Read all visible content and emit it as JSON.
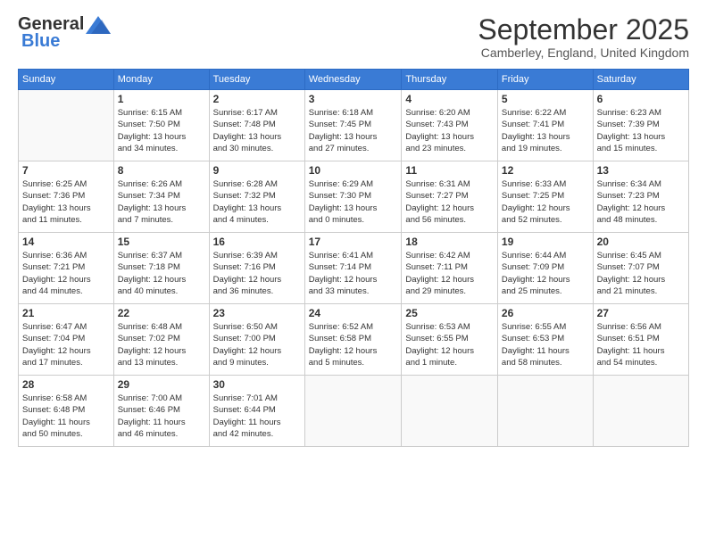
{
  "header": {
    "logo_general": "General",
    "logo_blue": "Blue",
    "month_title": "September 2025",
    "location": "Camberley, England, United Kingdom"
  },
  "days_of_week": [
    "Sunday",
    "Monday",
    "Tuesday",
    "Wednesday",
    "Thursday",
    "Friday",
    "Saturday"
  ],
  "weeks": [
    [
      {
        "day": "",
        "info": ""
      },
      {
        "day": "1",
        "info": "Sunrise: 6:15 AM\nSunset: 7:50 PM\nDaylight: 13 hours\nand 34 minutes."
      },
      {
        "day": "2",
        "info": "Sunrise: 6:17 AM\nSunset: 7:48 PM\nDaylight: 13 hours\nand 30 minutes."
      },
      {
        "day": "3",
        "info": "Sunrise: 6:18 AM\nSunset: 7:45 PM\nDaylight: 13 hours\nand 27 minutes."
      },
      {
        "day": "4",
        "info": "Sunrise: 6:20 AM\nSunset: 7:43 PM\nDaylight: 13 hours\nand 23 minutes."
      },
      {
        "day": "5",
        "info": "Sunrise: 6:22 AM\nSunset: 7:41 PM\nDaylight: 13 hours\nand 19 minutes."
      },
      {
        "day": "6",
        "info": "Sunrise: 6:23 AM\nSunset: 7:39 PM\nDaylight: 13 hours\nand 15 minutes."
      }
    ],
    [
      {
        "day": "7",
        "info": "Sunrise: 6:25 AM\nSunset: 7:36 PM\nDaylight: 13 hours\nand 11 minutes."
      },
      {
        "day": "8",
        "info": "Sunrise: 6:26 AM\nSunset: 7:34 PM\nDaylight: 13 hours\nand 7 minutes."
      },
      {
        "day": "9",
        "info": "Sunrise: 6:28 AM\nSunset: 7:32 PM\nDaylight: 13 hours\nand 4 minutes."
      },
      {
        "day": "10",
        "info": "Sunrise: 6:29 AM\nSunset: 7:30 PM\nDaylight: 13 hours\nand 0 minutes."
      },
      {
        "day": "11",
        "info": "Sunrise: 6:31 AM\nSunset: 7:27 PM\nDaylight: 12 hours\nand 56 minutes."
      },
      {
        "day": "12",
        "info": "Sunrise: 6:33 AM\nSunset: 7:25 PM\nDaylight: 12 hours\nand 52 minutes."
      },
      {
        "day": "13",
        "info": "Sunrise: 6:34 AM\nSunset: 7:23 PM\nDaylight: 12 hours\nand 48 minutes."
      }
    ],
    [
      {
        "day": "14",
        "info": "Sunrise: 6:36 AM\nSunset: 7:21 PM\nDaylight: 12 hours\nand 44 minutes."
      },
      {
        "day": "15",
        "info": "Sunrise: 6:37 AM\nSunset: 7:18 PM\nDaylight: 12 hours\nand 40 minutes."
      },
      {
        "day": "16",
        "info": "Sunrise: 6:39 AM\nSunset: 7:16 PM\nDaylight: 12 hours\nand 36 minutes."
      },
      {
        "day": "17",
        "info": "Sunrise: 6:41 AM\nSunset: 7:14 PM\nDaylight: 12 hours\nand 33 minutes."
      },
      {
        "day": "18",
        "info": "Sunrise: 6:42 AM\nSunset: 7:11 PM\nDaylight: 12 hours\nand 29 minutes."
      },
      {
        "day": "19",
        "info": "Sunrise: 6:44 AM\nSunset: 7:09 PM\nDaylight: 12 hours\nand 25 minutes."
      },
      {
        "day": "20",
        "info": "Sunrise: 6:45 AM\nSunset: 7:07 PM\nDaylight: 12 hours\nand 21 minutes."
      }
    ],
    [
      {
        "day": "21",
        "info": "Sunrise: 6:47 AM\nSunset: 7:04 PM\nDaylight: 12 hours\nand 17 minutes."
      },
      {
        "day": "22",
        "info": "Sunrise: 6:48 AM\nSunset: 7:02 PM\nDaylight: 12 hours\nand 13 minutes."
      },
      {
        "day": "23",
        "info": "Sunrise: 6:50 AM\nSunset: 7:00 PM\nDaylight: 12 hours\nand 9 minutes."
      },
      {
        "day": "24",
        "info": "Sunrise: 6:52 AM\nSunset: 6:58 PM\nDaylight: 12 hours\nand 5 minutes."
      },
      {
        "day": "25",
        "info": "Sunrise: 6:53 AM\nSunset: 6:55 PM\nDaylight: 12 hours\nand 1 minute."
      },
      {
        "day": "26",
        "info": "Sunrise: 6:55 AM\nSunset: 6:53 PM\nDaylight: 11 hours\nand 58 minutes."
      },
      {
        "day": "27",
        "info": "Sunrise: 6:56 AM\nSunset: 6:51 PM\nDaylight: 11 hours\nand 54 minutes."
      }
    ],
    [
      {
        "day": "28",
        "info": "Sunrise: 6:58 AM\nSunset: 6:48 PM\nDaylight: 11 hours\nand 50 minutes."
      },
      {
        "day": "29",
        "info": "Sunrise: 7:00 AM\nSunset: 6:46 PM\nDaylight: 11 hours\nand 46 minutes."
      },
      {
        "day": "30",
        "info": "Sunrise: 7:01 AM\nSunset: 6:44 PM\nDaylight: 11 hours\nand 42 minutes."
      },
      {
        "day": "",
        "info": ""
      },
      {
        "day": "",
        "info": ""
      },
      {
        "day": "",
        "info": ""
      },
      {
        "day": "",
        "info": ""
      }
    ]
  ]
}
